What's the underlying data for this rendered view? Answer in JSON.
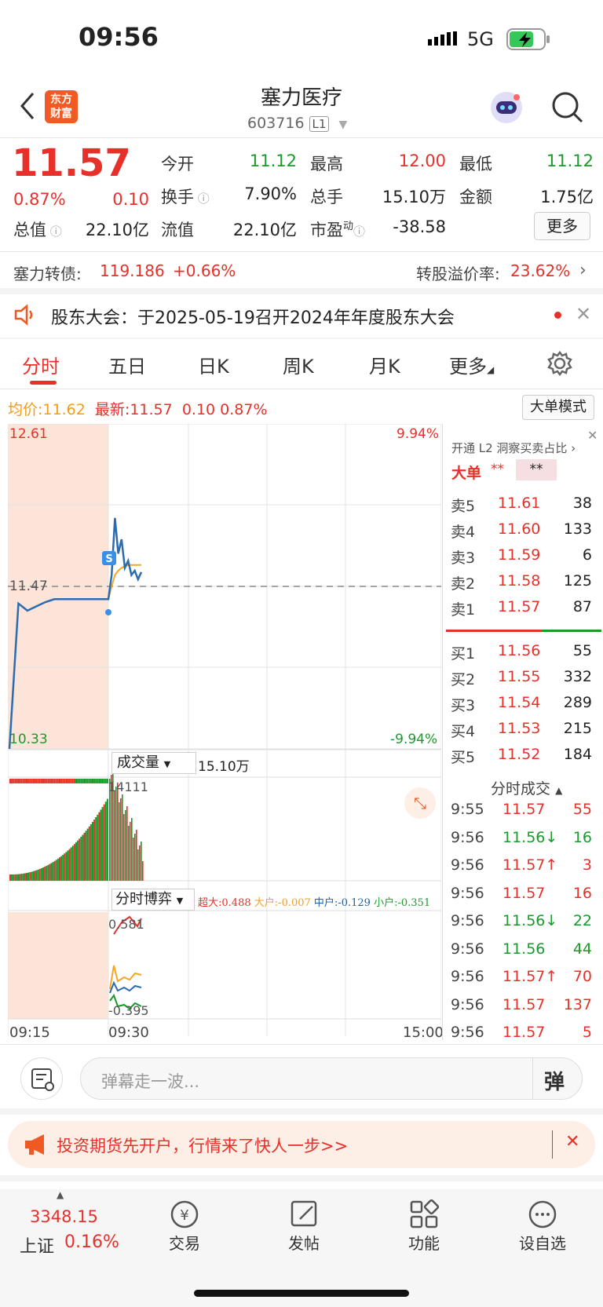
{
  "status": {
    "time": "09:56",
    "network": "5G"
  },
  "header": {
    "title": "塞力医疗",
    "code": "603716",
    "level": "L1",
    "logo_line1": "东方",
    "logo_line2": "财富"
  },
  "quote": {
    "price": "11.57",
    "change_pct": "0.87%",
    "change": "0.10",
    "open_label": "今开",
    "open": "11.12",
    "high_label": "最高",
    "high": "12.00",
    "low_label": "最低",
    "low": "11.12",
    "turnover_label": "换手",
    "turnover": "7.90%",
    "volume_label": "总手",
    "volume": "15.10万",
    "amount_label": "金额",
    "amount": "1.75亿",
    "total_mv_label": "总值",
    "total_mv": "22.10亿",
    "float_mv_label": "流值",
    "float_mv": "22.10亿",
    "pe_label": "市盈",
    "pe_sup": "动",
    "pe": "-38.58",
    "more_label": "更多"
  },
  "bond": {
    "label": "塞力转债:",
    "price": "119.186",
    "change": "+0.66%",
    "premium_label": "转股溢价率:",
    "premium": "23.62%"
  },
  "notice": {
    "text": "股东大会：于2025-05-19召开2024年年度股东大会"
  },
  "tabs": [
    "分时",
    "五日",
    "日K",
    "周K",
    "月K",
    "更多"
  ],
  "chart_info": {
    "avg_label": "均价:",
    "avg": "11.62",
    "latest_label": "最新:",
    "latest": "11.57",
    "latest_change": "0.10",
    "latest_pct": "0.87%",
    "big_mode": "大单模式"
  },
  "chart_data": {
    "type": "line",
    "y_max_label": "12.61",
    "y_min_label": "10.33",
    "prev_close_label": "11.47",
    "pct_max_label": "9.94%",
    "pct_min_label": "-9.94%",
    "x_ticks": [
      "09:15",
      "09:30",
      "15:00"
    ],
    "ylim": [
      10.33,
      12.61
    ],
    "prev_close": 11.47,
    "price_series": [
      10.33,
      11.35,
      11.3,
      11.33,
      11.36,
      11.38,
      11.38,
      11.38,
      11.38,
      11.38,
      11.38,
      11.38,
      11.55,
      11.95,
      11.7,
      11.8,
      11.6,
      11.65,
      11.55,
      11.58,
      11.52,
      11.57
    ],
    "avg_series": [
      11.38,
      11.38,
      11.38,
      11.38,
      11.38,
      11.38,
      11.38,
      11.38,
      11.38,
      11.38,
      11.38,
      11.38,
      11.47,
      11.55,
      11.58,
      11.6,
      11.61,
      11.62,
      11.62,
      11.62,
      11.62,
      11.62
    ],
    "volume_label": "成交量",
    "volume_total": "15.10万",
    "volume_max_label": "14111",
    "game_label": "分时博弈",
    "game_legend": [
      {
        "name": "超大",
        "value": "0.488",
        "color": "#e8302a"
      },
      {
        "name": "大户",
        "value": "-0.007",
        "color": "#f0a020"
      },
      {
        "name": "中户",
        "value": "-0.129",
        "color": "#1f5fa8"
      },
      {
        "name": "小户",
        "value": "-0.351",
        "color": "#1a9a2b"
      }
    ],
    "game_max_label": "0.581",
    "game_min_label": "-0.395"
  },
  "orderbook": {
    "header": "开通 L2 洞察买卖占比",
    "big_label": "大单",
    "big_val1": "**",
    "big_val2": "**",
    "asks": [
      {
        "label": "卖5",
        "price": "11.61",
        "vol": "38"
      },
      {
        "label": "卖4",
        "price": "11.60",
        "vol": "133"
      },
      {
        "label": "卖3",
        "price": "11.59",
        "vol": "6"
      },
      {
        "label": "卖2",
        "price": "11.58",
        "vol": "125"
      },
      {
        "label": "卖1",
        "price": "11.57",
        "vol": "87"
      }
    ],
    "bids": [
      {
        "label": "买1",
        "price": "11.56",
        "vol": "55"
      },
      {
        "label": "买2",
        "price": "11.55",
        "vol": "332"
      },
      {
        "label": "买3",
        "price": "11.54",
        "vol": "289"
      },
      {
        "label": "买4",
        "price": "11.53",
        "vol": "215"
      },
      {
        "label": "买5",
        "price": "11.52",
        "vol": "184"
      }
    ]
  },
  "trades": {
    "title": "分时成交",
    "rows": [
      {
        "time": "9:55",
        "price": "11.57",
        "vol": "55",
        "pc": "red",
        "vc": "red"
      },
      {
        "time": "9:56",
        "price": "11.56↓",
        "vol": "16",
        "pc": "green",
        "vc": "green"
      },
      {
        "time": "9:56",
        "price": "11.57↑",
        "vol": "3",
        "pc": "red",
        "vc": "red"
      },
      {
        "time": "9:56",
        "price": "11.57",
        "vol": "16",
        "pc": "red",
        "vc": "red"
      },
      {
        "time": "9:56",
        "price": "11.56↓",
        "vol": "22",
        "pc": "green",
        "vc": "green"
      },
      {
        "time": "9:56",
        "price": "11.56",
        "vol": "44",
        "pc": "green",
        "vc": "green"
      },
      {
        "time": "9:56",
        "price": "11.57↑",
        "vol": "70",
        "pc": "red",
        "vc": "red"
      },
      {
        "time": "9:56",
        "price": "11.57",
        "vol": "137",
        "pc": "red",
        "vc": "red"
      },
      {
        "time": "9:56",
        "price": "11.57",
        "vol": "5",
        "pc": "red",
        "vc": "red"
      }
    ]
  },
  "comment": {
    "placeholder": "弹幕走一波...",
    "send_label": "弹"
  },
  "ad": {
    "text": "投资期货先开户，行情来了快人一步>>"
  },
  "bottom_nav": {
    "index_value": "3348.15",
    "index_name": "上证",
    "index_pct": "0.16%",
    "items": [
      "交易",
      "发帖",
      "功能",
      "设自选"
    ]
  }
}
